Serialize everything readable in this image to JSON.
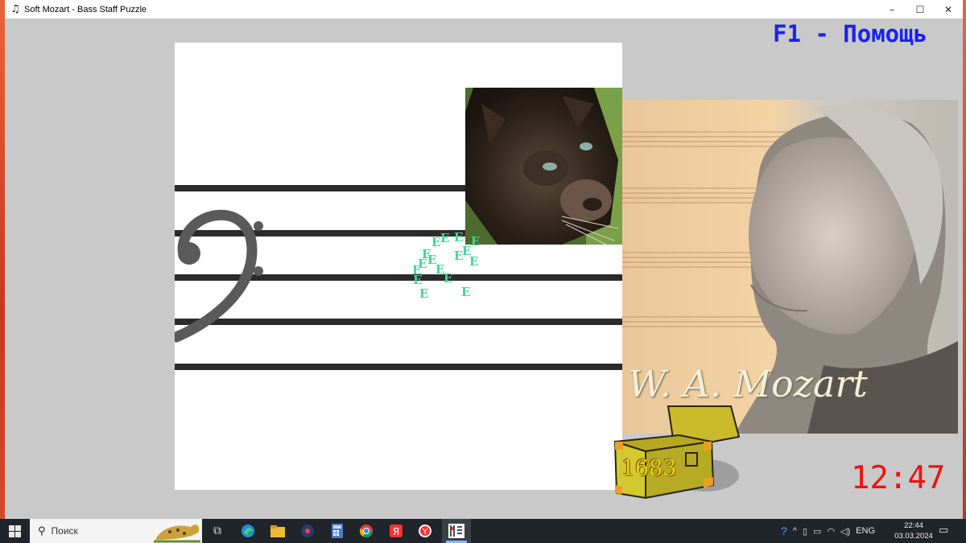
{
  "window": {
    "title": "Soft Mozart - Bass Staff Puzzle",
    "app_icon": "music-note-icon",
    "minimize_glyph": "–",
    "maximize_glyph": "☐",
    "close_glyph": "✕"
  },
  "game": {
    "help_text": "F1 - Помощь",
    "score": "1683",
    "timer": "12:47",
    "signature": "W. A. Mozart",
    "floating_letter": "E",
    "colors": {
      "help": "#1a22ee",
      "timer": "#ee1111",
      "score": "#f5d116",
      "letters": "#3fd69a"
    }
  },
  "taskbar": {
    "search_placeholder": "Поиск",
    "language": "ENG",
    "time": "22:44",
    "date": "03.03.2024",
    "apps": [
      "task-view-icon",
      "edge-icon",
      "file-explorer-icon",
      "media-app-icon",
      "calculator-icon",
      "chrome-icon",
      "yandex-icon",
      "yandex-browser-icon",
      "soft-mozart-icon"
    ]
  }
}
